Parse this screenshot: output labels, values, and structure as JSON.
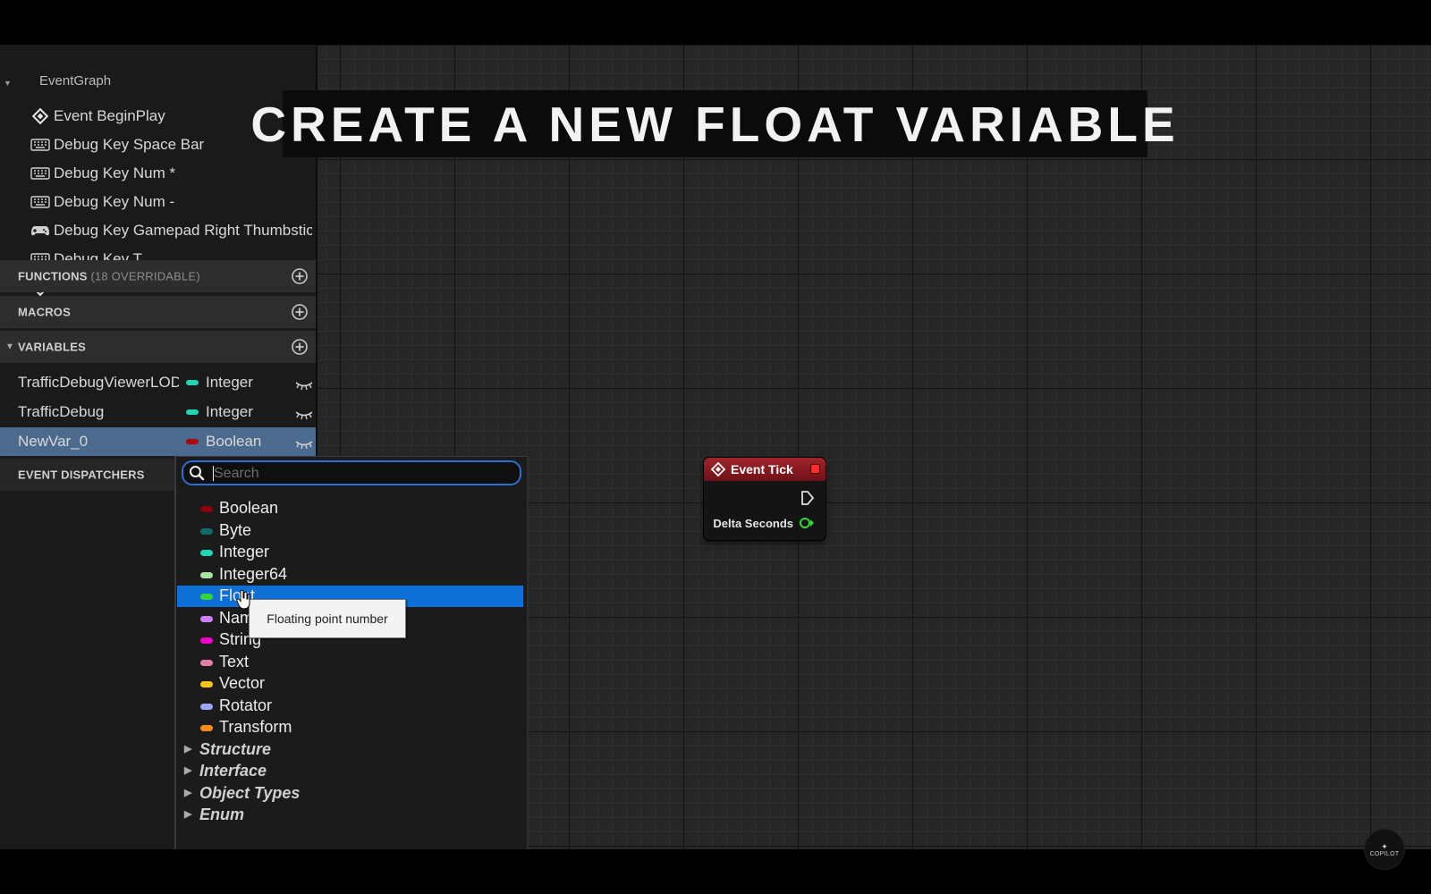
{
  "banner": {
    "text": "CREATE A NEW FLOAT VARIABLE"
  },
  "my_blueprint": {
    "event_graph_label": "EventGraph",
    "events": [
      {
        "label": "Event BeginPlay",
        "icon": "event-diamond-icon"
      },
      {
        "label": "Debug Key Space Bar",
        "icon": "keyboard-icon"
      },
      {
        "label": "Debug Key Num *",
        "icon": "keyboard-icon"
      },
      {
        "label": "Debug Key Num -",
        "icon": "keyboard-icon"
      },
      {
        "label": "Debug Key Gamepad Right Thumbstick",
        "icon": "gamepad-icon"
      },
      {
        "label": "Debug Key T",
        "icon": "keyboard-icon"
      },
      {
        "label": "Event Tick",
        "icon": "event-diamond-icon"
      }
    ],
    "functions": {
      "label": "FUNCTIONS",
      "sub": "(18 OVERRIDABLE)"
    },
    "macros": {
      "label": "MACROS"
    },
    "variables": {
      "label": "VARIABLES",
      "items": [
        {
          "name": "TrafficDebugViewerLOD",
          "type": "Integer",
          "color": "#1fd6b0"
        },
        {
          "name": "TrafficDebug",
          "type": "Integer",
          "color": "#1fd6b0"
        },
        {
          "name": "NewVar_0",
          "type": "Boolean",
          "color": "#b0000d"
        }
      ]
    },
    "event_dispatchers": {
      "label": "EVENT DISPATCHERS"
    }
  },
  "type_picker": {
    "search_placeholder": "Search",
    "types": [
      {
        "label": "Boolean",
        "color": "#8c0010"
      },
      {
        "label": "Byte",
        "color": "#0f6d67"
      },
      {
        "label": "Integer",
        "color": "#1fd6b0"
      },
      {
        "label": "Integer64",
        "color": "#a8e3a0"
      },
      {
        "label": "Float",
        "color": "#39d437"
      },
      {
        "label": "Name",
        "color": "#c882f5"
      },
      {
        "label": "String",
        "color": "#f500c8"
      },
      {
        "label": "Text",
        "color": "#e57ea7"
      },
      {
        "label": "Vector",
        "color": "#f7c419"
      },
      {
        "label": "Rotator",
        "color": "#9ea7ff"
      },
      {
        "label": "Transform",
        "color": "#f58b18"
      }
    ],
    "categories": [
      "Structure",
      "Interface",
      "Object Types",
      "Enum"
    ],
    "selected": "Float",
    "tooltip": "Floating point number"
  },
  "node": {
    "title": "Event Tick",
    "output_pin": "Delta Seconds",
    "pin_color": "#39d437"
  },
  "watermark": {
    "text": "COPILOT"
  }
}
